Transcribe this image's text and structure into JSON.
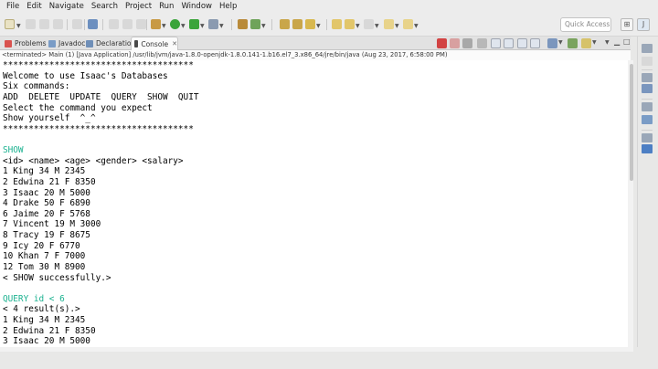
{
  "menu": [
    "File",
    "Edit",
    "Navigate",
    "Search",
    "Project",
    "Run",
    "Window",
    "Help"
  ],
  "quick_access": {
    "placeholder": "Quick Access"
  },
  "tabs": [
    {
      "label": "Problems",
      "icon": "problems-icon",
      "active": false
    },
    {
      "label": "Javadoc",
      "icon": "javadoc-icon",
      "active": false
    },
    {
      "label": "Declaration",
      "icon": "declaration-icon",
      "active": false
    },
    {
      "label": "Console",
      "icon": "console-icon",
      "active": true
    }
  ],
  "process_line": "<terminated> Main (1) [Java Application] /usr/lib/jvm/java-1.8.0-openjdk-1.8.0.141-1.b16.el7_3.x86_64/jre/bin/java (Aug 23, 2017, 6:58:00 PM)",
  "console_lines": [
    {
      "text": "*************************************",
      "type": "out"
    },
    {
      "text": "Welcome to use Isaac's Databases",
      "type": "out"
    },
    {
      "text": "Six commands:",
      "type": "out"
    },
    {
      "text": "ADD  DELETE  UPDATE  QUERY  SHOW  QUIT",
      "type": "out"
    },
    {
      "text": "Select the command you expect",
      "type": "out"
    },
    {
      "text": "Show yourself  ^_^",
      "type": "out"
    },
    {
      "text": "*************************************",
      "type": "out"
    },
    {
      "text": "",
      "type": "out"
    },
    {
      "text": "SHOW",
      "type": "cmd"
    },
    {
      "text": "<id> <name> <age> <gender> <salary>",
      "type": "out"
    },
    {
      "text": "1 King 34 M 2345",
      "type": "out"
    },
    {
      "text": "2 Edwina 21 F 8350",
      "type": "out"
    },
    {
      "text": "3 Isaac 20 M 5000",
      "type": "out"
    },
    {
      "text": "4 Drake 50 F 6890",
      "type": "out"
    },
    {
      "text": "6 Jaime 20 F 5768",
      "type": "out"
    },
    {
      "text": "7 Vincent 19 M 3000",
      "type": "out"
    },
    {
      "text": "8 Tracy 19 F 8675",
      "type": "out"
    },
    {
      "text": "9 Icy 20 F 6770",
      "type": "out"
    },
    {
      "text": "10 Khan 7 F 7000",
      "type": "out"
    },
    {
      "text": "12 Tom 30 M 8900",
      "type": "out"
    },
    {
      "text": "< SHOW successfully.>",
      "type": "out"
    },
    {
      "text": "",
      "type": "out"
    },
    {
      "text": "QUERY id < 6",
      "type": "cmd"
    },
    {
      "text": "< 4 result(s).>",
      "type": "out"
    },
    {
      "text": "1 King 34 M 2345",
      "type": "out"
    },
    {
      "text": "2 Edwina 21 F 8350",
      "type": "out"
    },
    {
      "text": "3 Isaac 20 M 5000",
      "type": "out"
    }
  ],
  "colors": {
    "input_text": "#1ab18f",
    "output_text": "#000000",
    "terminate_red": "#d24343",
    "run_green": "#3aa43a"
  }
}
